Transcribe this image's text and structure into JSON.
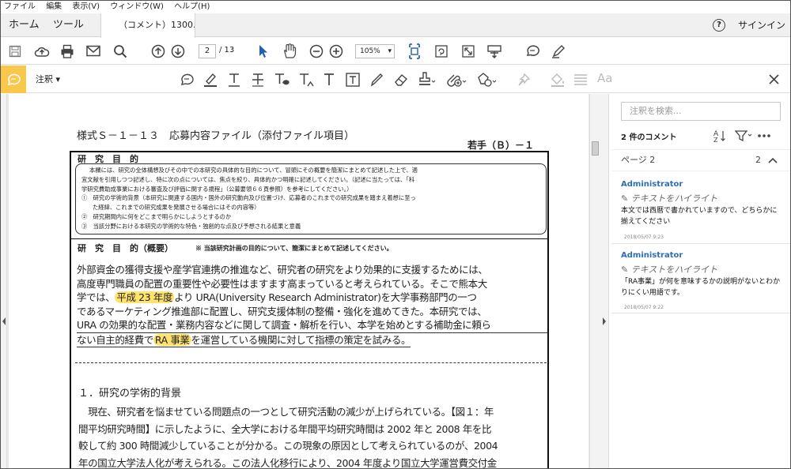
{
  "menu": [
    "ファイル",
    "編集",
    "表示(V)",
    "ウィンドウ(W)",
    "ヘルプ(H)"
  ],
  "tabs": {
    "home": "ホーム",
    "tools": "ツール",
    "doc": "（コメント）1300..."
  },
  "signin": "サインイン",
  "help_glyph": "?",
  "toolbar": {
    "page_current": "2",
    "page_total": "/ 13",
    "zoom": "105%"
  },
  "comment_bar": {
    "label": "注釈",
    "font_tool": "Aa"
  },
  "icons": [
    "save-icon",
    "upload-icon",
    "print-icon",
    "mail-icon",
    "search-icon",
    "page-up-icon",
    "page-down-icon",
    "cursor-icon",
    "hand-icon",
    "zoom-out-icon",
    "zoom-in-icon",
    "fit-page-icon",
    "rotate-icon",
    "full-screen-icon",
    "tools-icon",
    "comment-icon",
    "pen-icon",
    "sticky-note-icon",
    "highlight-icon",
    "underline-icon",
    "strikethrough-icon",
    "replace-icon",
    "insert-text-icon",
    "textbox-icon",
    "draw-icon",
    "eraser-icon",
    "stamp-icon",
    "attach-icon",
    "shapes-icon",
    "pin-icon",
    "fill-icon",
    "lines-icon",
    "close-icon",
    "sort-icon",
    "filter-icon",
    "more-icon",
    "chevron-up-icon"
  ],
  "document": {
    "form_title": "様式Ｓ－１－１３　応募内容ファイル（添付ファイル項目）",
    "applicant": "若手（Ｂ）－１",
    "box_title": "研　究　目　的",
    "box_lines": [
      "本欄には、研究の全体構想及びその中での本研究の具体的な目的について、冒頭にその概要を簡潔にまとめて記述した上で、適",
      "宜文献を引用しつつ記述し、特に次の点については、焦点を絞り、具体的かつ明確に記述してください。（記述に当たっては、「科",
      "学研究費助成事業における審査及び評価に関する規程」（公募要領６６頁参照）を参考にしてください。）",
      "①　研究の学術的背景（本研究に関連する国内・国外の研究動向及び位置づけ、応募者のこれまでの研究成果を踏まえ着想に至っ",
      "た経緯、これまでの研究成果を発展させる場合にはその内容等）",
      "②　研究期間内に何をどこまで明らかにしようとするのか",
      "③　当該分野における本研究の学術的な特色・独創的な点及び予想される結果と意義"
    ],
    "summary_title": "研　究　目　的（概要）",
    "summary_note": "※ 当該研究計画の目的について、簡潔にまとめて記述してください。",
    "summary_lines": [
      {
        "before": "外部資金の獲得支援や産学官連携の推進など、研究者の研究をより効果的に支援するためには、",
        "hl": "",
        "after": ""
      },
      {
        "before": "高度専門職員の配置の重要性や必要性はますます高まっていると考えられている。そこで熊本大",
        "hl": "",
        "after": ""
      },
      {
        "before": "学では、",
        "hl": "平成 23 年度",
        "after": "より URA(University Research Administrator)を大学事務部門の一つ"
      },
      {
        "before": "であるマーケティング推進部に配置し、研究支援体制の整備・強化を進めてきた。本研究では、",
        "hl": "",
        "after": ""
      },
      {
        "before": "URA の効果的な配置・業務内容などに関して調査・解析を行い、本学を始めとする補助金に頼ら",
        "hl": "",
        "after": ""
      },
      {
        "before": "ない自主的経費で",
        "hl": "RA 事業",
        "after": "を運営している機関に対して指標の策定を試みる。"
      }
    ],
    "section_heading": "１．研究の学術的背景",
    "body_lines": [
      "　現在、研究者を悩ませている問題点の一つとして研究活動の減少が上げられている。【図１：年",
      "間平均研究時間】に示したように、全大学における年間平均研究時間は 2002 年と 2008 年を比",
      "較して約 300 時間減少していることが分かる。この現象の原因として考えられているのが、2004",
      "年の国立大学法人化が考えられる。この法人化移行により、2004 年度より国立大学運営費交付金"
    ]
  },
  "comments_pane": {
    "search_placeholder": "注釈を検索...",
    "count": "2 件のコメント",
    "page_label": "ページ 2",
    "page_count": "2",
    "items": [
      {
        "author": "Administrator",
        "type": "テキストをハイライト",
        "body": "本文では西暦で書かれていますので、どちらかに揃えてください",
        "date": "2018/05/07  9:23"
      },
      {
        "author": "Administrator",
        "type": "テキストをハイライト",
        "body": "「RA事業」が何を意味するかの説明がないとわかりにくい用語です。",
        "date": "2018/05/07  9:22"
      }
    ]
  },
  "colors": {
    "accent": "#f9c74a",
    "highlight": "#ffe36a",
    "author": "#2d6db5",
    "cursor": "#1f5fb4"
  }
}
